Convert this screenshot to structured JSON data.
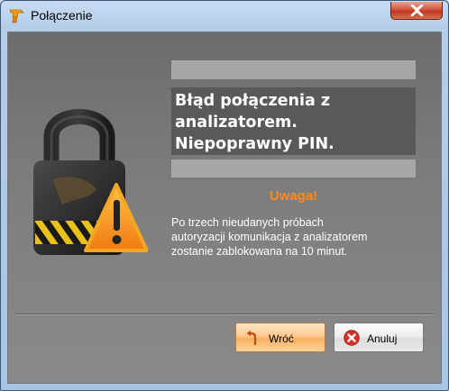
{
  "window": {
    "title": "Połączenie",
    "app_icon": "app-logo-icon",
    "close_icon": "close-icon"
  },
  "error": {
    "message": "Błąd połączenia z\nanalizatorem.\nNiepoprawny PIN."
  },
  "warning": {
    "title": "Uwaga!",
    "message": "Po trzech nieudanych próbach\nautoryzacji komunikacja z analizatorem\nzostanie zablokowana na 10 minut."
  },
  "buttons": {
    "back_label": "Wróć",
    "back_icon": "undo-arrow-icon",
    "cancel_label": "Anuluj",
    "cancel_icon": "cancel-x-icon"
  },
  "colors": {
    "warning_title": "#ff8a1c",
    "close_button": "#c1381f",
    "back_button": "#f8b15f"
  }
}
